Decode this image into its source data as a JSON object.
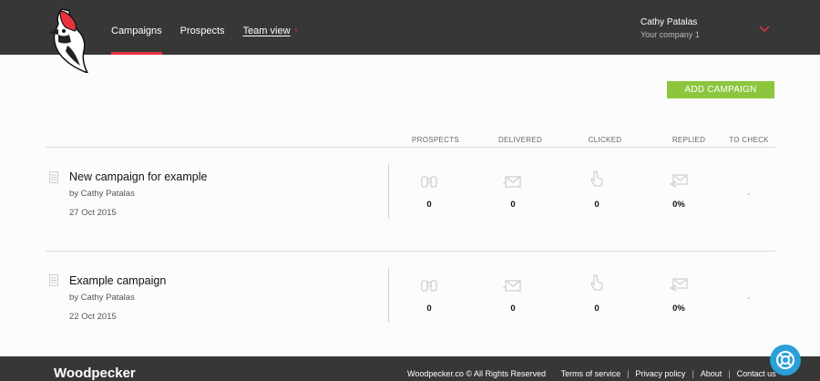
{
  "nav": {
    "items": [
      "Campaigns",
      "Prospects",
      "Team view"
    ],
    "active": 0
  },
  "user": {
    "name": "Cathy Patalas",
    "company": "Your company 1"
  },
  "actions": {
    "add_campaign": "ADD CAMPAIGN"
  },
  "table": {
    "columns": [
      "PROSPECTS",
      "DELIVERED",
      "CLICKED",
      "REPLIED",
      "TO CHECK"
    ],
    "campaigns": [
      {
        "title": "New campaign for example",
        "by": "by Cathy Patalas",
        "date": "27 Oct 2015",
        "prospects": "0",
        "delivered": "0",
        "clicked": "0",
        "replied": "0%",
        "to_check": "-"
      },
      {
        "title": "Example campaign",
        "by": "by Cathy Patalas",
        "date": "22 Oct 2015",
        "prospects": "0",
        "delivered": "0",
        "clicked": "0",
        "replied": "0%",
        "to_check": "-"
      }
    ]
  },
  "footer": {
    "brand": "Woodpecker",
    "copyright": "Woodpecker.co © All Rights Reserved",
    "links": [
      "Terms of service",
      "Privacy policy",
      "About",
      "Contact us"
    ]
  },
  "colors": {
    "accent_red": "#e8333f",
    "accent_green": "#8cc63f",
    "dark_bar": "#373737",
    "help_blue": "#2a9fd8"
  },
  "icons": [
    "woodpecker-logo",
    "chevron-down-icon",
    "document-icon",
    "binoculars-icon",
    "envelope-icon",
    "pointer-hand-icon",
    "reply-envelope-icon",
    "lifebuoy-icon"
  ]
}
